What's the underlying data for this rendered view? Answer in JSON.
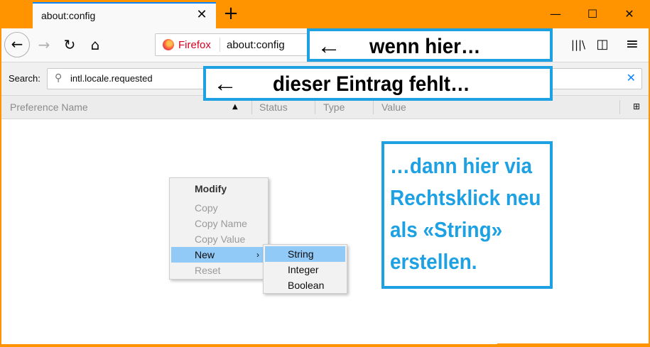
{
  "tab": {
    "title": "about:config",
    "close": "✕",
    "new_tab": "+"
  },
  "window_controls": {
    "minimize": "—",
    "maximize": "☐",
    "close": "✕"
  },
  "nav": {
    "back": "←",
    "forward": "→",
    "reload": "↻",
    "home": "⌂",
    "identity_label": "Firefox",
    "url": "about:config",
    "library": "|||\\",
    "sidebar": "◫",
    "menu": "≡"
  },
  "search": {
    "label": "Search:",
    "value": "intl.locale.requested",
    "clear": "✕"
  },
  "columns": {
    "name": "Preference Name",
    "status": "Status",
    "type": "Type",
    "value": "Value",
    "sort_glyph": "▲",
    "picker_glyph": "⊞"
  },
  "context_menu": {
    "items": [
      {
        "label": "Modify",
        "enabled": true
      },
      {
        "label": "Copy",
        "enabled": false
      },
      {
        "label": "Copy Name",
        "enabled": false
      },
      {
        "label": "Copy Value",
        "enabled": false
      },
      {
        "label": "New",
        "enabled": true,
        "highlighted": true,
        "arrow": "›"
      },
      {
        "label": "Reset",
        "enabled": false
      }
    ]
  },
  "submenu": {
    "items": [
      {
        "label": "String",
        "highlighted": true
      },
      {
        "label": "Integer"
      },
      {
        "label": "Boolean"
      }
    ]
  },
  "annotations": {
    "box1": {
      "arrow": "←",
      "text": "wenn hier…"
    },
    "box2": {
      "arrow": "←",
      "text": "dieser Eintrag fehlt…"
    },
    "box3": {
      "lines": [
        "…dann hier via",
        "Rechtsklick neu",
        "als «String»",
        "erstellen."
      ]
    }
  },
  "colors": {
    "frame": "#ff9400",
    "accent": "#0a84ff",
    "annotation": "#1da1e2",
    "menu_highlight": "#91c9f7"
  }
}
